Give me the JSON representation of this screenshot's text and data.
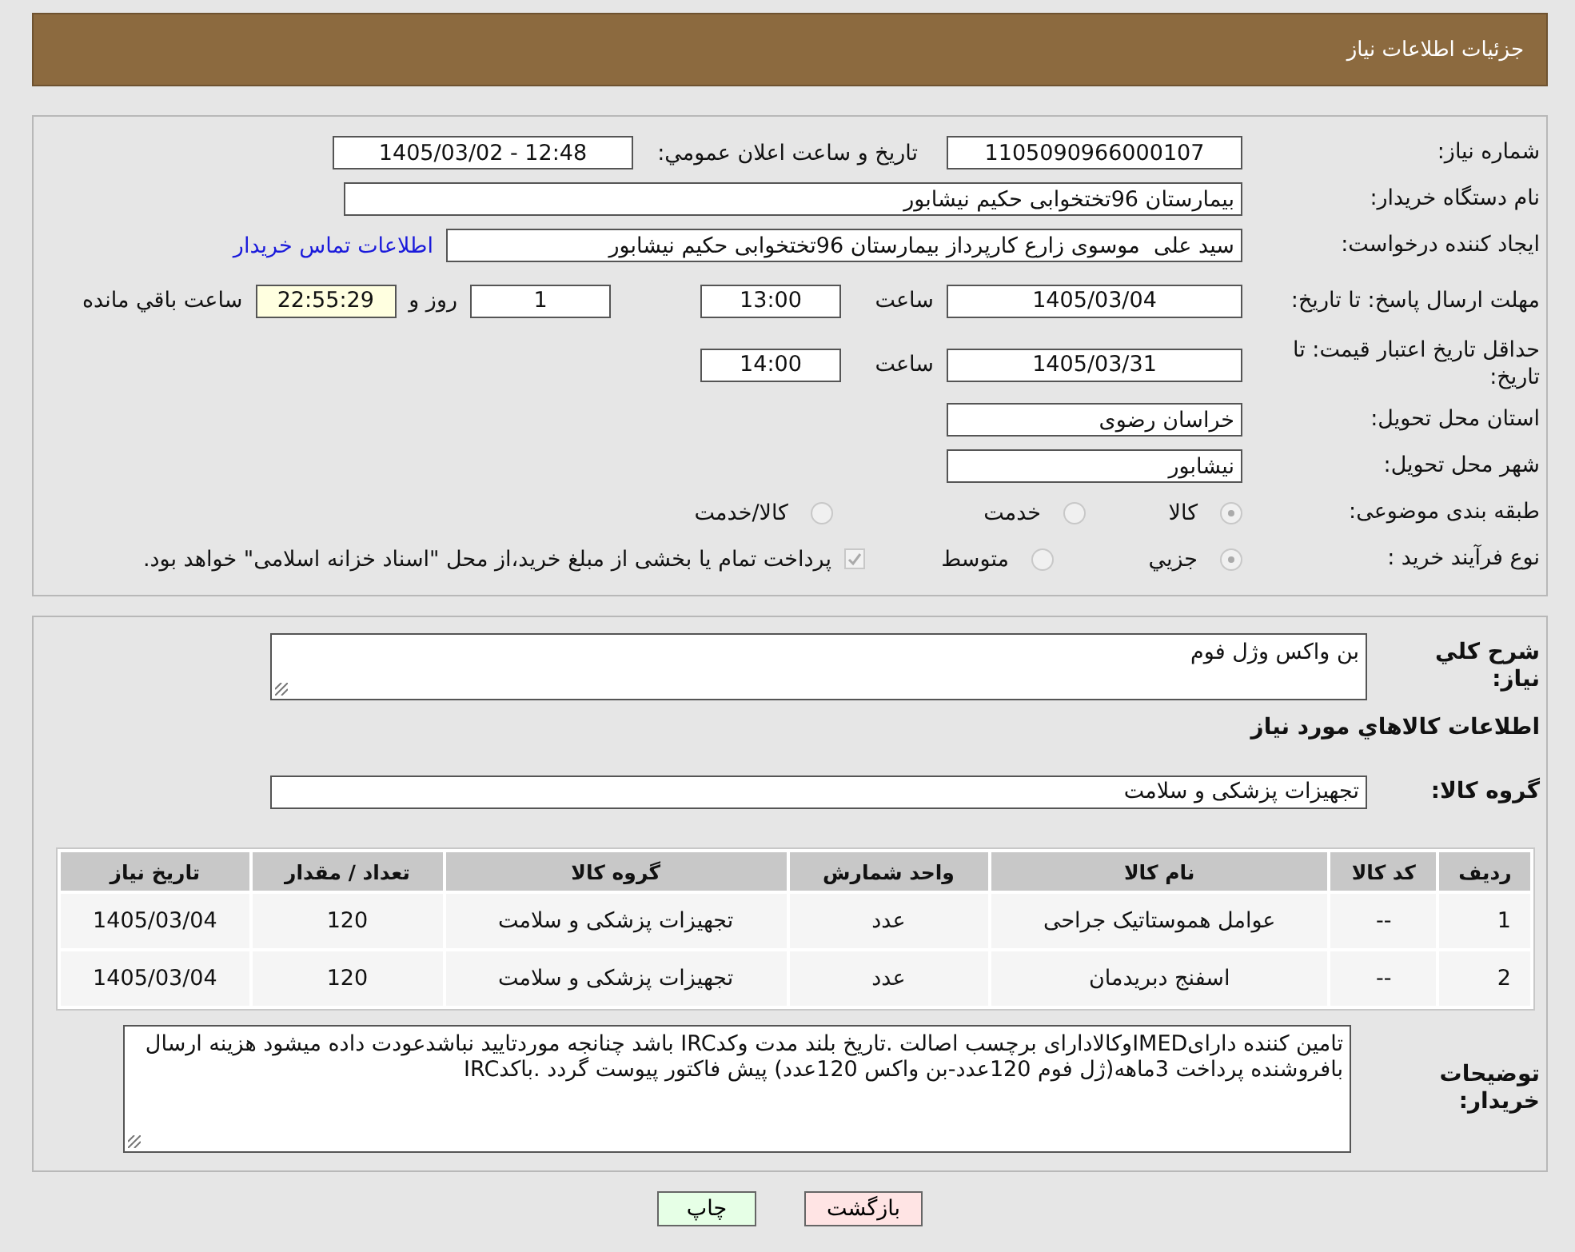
{
  "header": {
    "title": "جزئیات اطلاعات نیاز"
  },
  "need_number": {
    "label": "شماره نیاز:",
    "value": "1105090966000107"
  },
  "announce": {
    "label": "تاریخ و ساعت اعلان عمومي:",
    "value": "1405/03/02 - 12:48"
  },
  "buyer_org": {
    "label": "نام دستگاه خریدار:",
    "value": "بیمارستان 96تختخوابی حکیم نیشابور"
  },
  "requester": {
    "label": "ایجاد کننده درخواست:",
    "value": "سید علی  موسوی زارع کارپرداز بیمارستان 96تختخوابی حکیم نیشابور",
    "link": "اطلاعات تماس خریدار"
  },
  "deadline": {
    "label": "مهلت ارسال پاسخ: تا تاریخ:",
    "date": "1405/03/04",
    "time_label": "ساعت",
    "time": "13:00",
    "days": "1",
    "days_label": "روز و",
    "remaining": "22:55:29",
    "remaining_label": "ساعت باقي مانده"
  },
  "validity": {
    "label": "حداقل تاریخ اعتبار قیمت: تا تاریخ:",
    "date": "1405/03/31",
    "time_label": "ساعت",
    "time": "14:00"
  },
  "province": {
    "label": "استان محل تحویل:",
    "value": "خراسان رضوی"
  },
  "city": {
    "label": "شهر محل تحویل:",
    "value": "نیشابور"
  },
  "category": {
    "label": "طبقه بندی موضوعی:",
    "options": [
      {
        "label": "کالا",
        "selected": true
      },
      {
        "label": "خدمت",
        "selected": false
      },
      {
        "label": "کالا/خدمت",
        "selected": false
      }
    ]
  },
  "purchase_type": {
    "label": "نوع فرآیند خرید :",
    "options": [
      {
        "label": "جزيي",
        "selected": true
      },
      {
        "label": "متوسط",
        "selected": false
      }
    ],
    "payment": {
      "checked": true,
      "text": "پرداخت تمام یا بخشی از مبلغ خرید،از محل \"اسناد خزانه اسلامی\" خواهد بود."
    }
  },
  "summary": {
    "label": "شرح کلي نیاز:",
    "value": "بن واکس وژل فوم"
  },
  "goods_heading": "اطلاعات کالاهاي مورد نیاز",
  "goods_group": {
    "label": "گروه کالا:",
    "value": "تجهیزات پزشکی و سلامت"
  },
  "table": {
    "columns": [
      "ردیف",
      "کد کالا",
      "نام کالا",
      "واحد شمارش",
      "گروه کالا",
      "تعداد / مقدار",
      "تاریخ نیاز"
    ],
    "rows": [
      [
        "1",
        "--",
        "عوامل هموستاتیک جراحی",
        "عدد",
        "تجهیزات پزشکی و سلامت",
        "120",
        "1405/03/04"
      ],
      [
        "2",
        "--",
        "اسفنج دبریدمان",
        "عدد",
        "تجهیزات پزشکی و سلامت",
        "120",
        "1405/03/04"
      ]
    ]
  },
  "buyer_notes": {
    "label": "توضیحات خریدار:",
    "value": "تامین کننده دارایIMEDوکالادارای برچسب اصالت .تاریخ بلند مدت وکدIRC باشد چنانجه موردتایید نباشدعودت داده میشود هزینه ارسال بافروشنده پرداخت 3ماهه(ژل فوم 120عدد-بن واکس 120عدد) پیش فاکتور پیوست گردد .باکدIRC"
  },
  "buttons": [
    {
      "label": "بازگشت",
      "kind": "back"
    },
    {
      "label": "چاپ",
      "kind": "print"
    }
  ]
}
